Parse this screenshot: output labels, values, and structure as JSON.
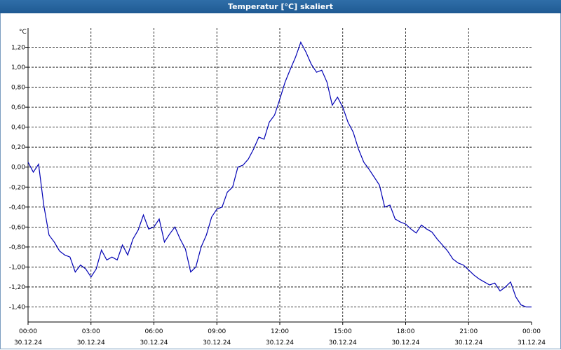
{
  "window": {
    "title": "Temperatur [°C] skaliert"
  },
  "chart_data": {
    "type": "line",
    "title": "Temperatur [°C] skaliert",
    "ylabel": "°C",
    "ylim": [
      -1.5,
      1.35
    ],
    "y_ticks": [
      "1,20",
      "1,00",
      "0,80",
      "0,60",
      "0,40",
      "0,20",
      "0,00",
      "-0,20",
      "-0,40",
      "-0,60",
      "-0,80",
      "-1,00",
      "-1,20",
      "-1,40"
    ],
    "x_ticks": [
      {
        "time": "00:00",
        "date": "30.12.24"
      },
      {
        "time": "03:00",
        "date": "30.12.24"
      },
      {
        "time": "06:00",
        "date": "30.12.24"
      },
      {
        "time": "09:00",
        "date": "30.12.24"
      },
      {
        "time": "12:00",
        "date": "30.12.24"
      },
      {
        "time": "15:00",
        "date": "30.12.24"
      },
      {
        "time": "18:00",
        "date": "30.12.24"
      },
      {
        "time": "21:00",
        "date": "30.12.24"
      },
      {
        "time": "00:00",
        "date": "31.12.24"
      }
    ],
    "grid": true,
    "line_color": "#0000b4",
    "series": [
      {
        "x": [
          "00:00",
          "00:15",
          "00:30",
          "00:45",
          "01:00",
          "01:15",
          "01:30",
          "01:45",
          "02:00",
          "02:15",
          "02:30",
          "02:45",
          "03:00",
          "03:15",
          "03:30",
          "03:45",
          "04:00",
          "04:15",
          "04:30",
          "04:45",
          "05:00",
          "05:15",
          "05:30",
          "05:45",
          "06:00",
          "06:15",
          "06:30",
          "06:45",
          "07:00",
          "07:15",
          "07:30",
          "07:45",
          "08:00",
          "08:15",
          "08:30",
          "08:45",
          "09:00",
          "09:15",
          "09:30",
          "09:45",
          "10:00",
          "10:15",
          "10:30",
          "10:45",
          "11:00",
          "11:15",
          "11:30",
          "11:45",
          "12:00",
          "12:15",
          "12:30",
          "12:45",
          "13:00",
          "13:15",
          "13:30",
          "13:45",
          "14:00",
          "14:15",
          "14:30",
          "14:45",
          "15:00",
          "15:15",
          "15:30",
          "15:45",
          "16:00",
          "16:15",
          "16:30",
          "16:45",
          "17:00",
          "17:15",
          "17:30",
          "17:45",
          "18:00",
          "18:15",
          "18:30",
          "18:45",
          "19:00",
          "19:15",
          "19:30",
          "19:45",
          "20:00",
          "20:15",
          "20:30",
          "20:45",
          "21:00",
          "21:15",
          "21:30",
          "21:45",
          "22:00",
          "22:15",
          "22:30",
          "22:45",
          "23:00",
          "23:15",
          "23:30",
          "23:45",
          "24:00"
        ],
        "values": [
          0.05,
          -0.05,
          0.03,
          -0.38,
          -0.68,
          -0.75,
          -0.84,
          -0.88,
          -0.9,
          -1.05,
          -0.98,
          -1.02,
          -1.1,
          -1.02,
          -0.83,
          -0.93,
          -0.9,
          -0.93,
          -0.78,
          -0.88,
          -0.72,
          -0.63,
          -0.48,
          -0.62,
          -0.6,
          -0.52,
          -0.75,
          -0.67,
          -0.6,
          -0.72,
          -0.82,
          -1.05,
          -1.0,
          -0.8,
          -0.68,
          -0.5,
          -0.42,
          -0.4,
          -0.25,
          -0.2,
          0.0,
          0.02,
          0.08,
          0.18,
          0.3,
          0.28,
          0.45,
          0.52,
          0.68,
          0.85,
          0.98,
          1.1,
          1.25,
          1.15,
          1.03,
          0.95,
          0.97,
          0.85,
          0.62,
          0.7,
          0.6,
          0.45,
          0.35,
          0.18,
          0.05,
          -0.02,
          -0.1,
          -0.18,
          -0.4,
          -0.38,
          -0.52,
          -0.55,
          -0.57,
          -0.62,
          -0.66,
          -0.58,
          -0.62,
          -0.65,
          -0.72,
          -0.78,
          -0.84,
          -0.92,
          -0.96,
          -0.98,
          -1.03,
          -1.08,
          -1.12,
          -1.15,
          -1.18,
          -1.16,
          -1.24,
          -1.2,
          -1.15,
          -1.3,
          -1.38,
          -1.4,
          -1.4
        ]
      }
    ]
  }
}
